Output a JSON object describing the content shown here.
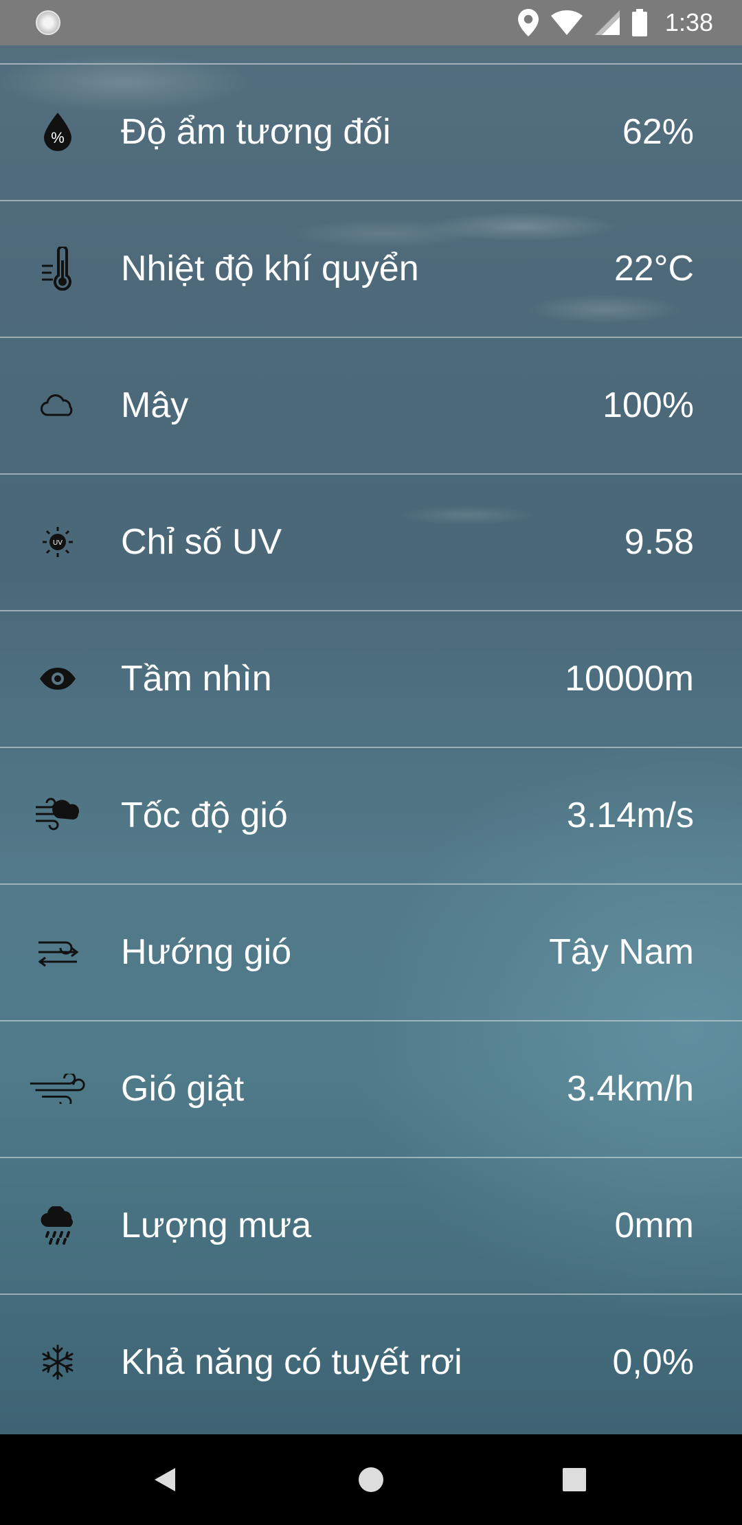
{
  "status_bar": {
    "time": "1:38",
    "icons": [
      "app-status-icon",
      "location-icon",
      "wifi-icon",
      "signal-icon",
      "battery-icon"
    ]
  },
  "weather_details": {
    "rows": [
      {
        "icon": "humidity-drop-icon",
        "label": "Độ ẩm tương đối",
        "value": "62%"
      },
      {
        "icon": "thermometer-icon",
        "label": "Nhiệt độ khí quyển",
        "value": "22°C"
      },
      {
        "icon": "cloud-icon",
        "label": "Mây",
        "value": "100%"
      },
      {
        "icon": "uv-sun-icon",
        "label": "Chỉ số UV",
        "value": "9.58"
      },
      {
        "icon": "eye-icon",
        "label": "Tầm nhìn",
        "value": "10000m"
      },
      {
        "icon": "wind-speed-icon",
        "label": "Tốc độ gió",
        "value": "3.14m/s"
      },
      {
        "icon": "wind-direction-icon",
        "label": "Hướng gió",
        "value": "Tây Nam"
      },
      {
        "icon": "wind-gust-icon",
        "label": "Gió giật",
        "value": "3.4km/h"
      },
      {
        "icon": "rain-cloud-icon",
        "label": "Lượng mưa",
        "value": "0mm"
      },
      {
        "icon": "snowflake-icon",
        "label": "Khả năng có tuyết rơi",
        "value": "0,0%"
      }
    ]
  },
  "nav_bar": {
    "buttons": [
      "back-button",
      "home-button",
      "recents-button"
    ]
  }
}
